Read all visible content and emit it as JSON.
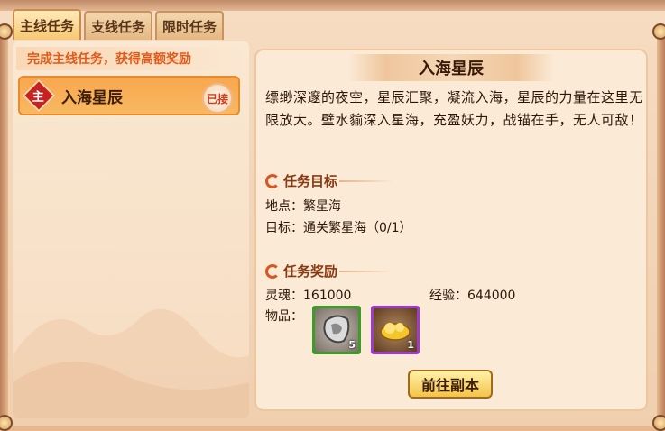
{
  "tabs": [
    {
      "label": "主线任务",
      "active": true
    },
    {
      "label": "支线任务",
      "active": false
    },
    {
      "label": "限时任务",
      "active": false
    }
  ],
  "left": {
    "hint": "完成主线任务，获得高额奖励",
    "task": {
      "badge": "主",
      "name": "入海星辰",
      "status": "已接"
    }
  },
  "detail": {
    "title": "入海星辰",
    "description": "缥缈深邃的夜空，星辰汇聚，凝流入海，星辰的力量在这里无限放大。壁水貐深入星海，充盈妖力，战锚在手，无人可敌！",
    "objective_header": "任务目标",
    "location_label": "地点：",
    "location_value": "繁星海",
    "goal_label": "目标：",
    "goal_value": "通关繁星海（0/1）",
    "reward_header": "任务奖励",
    "soul_label": "灵魂：",
    "soul_value": "161000",
    "exp_label": "经验：",
    "exp_value": "644000",
    "items_label": "物品：",
    "items": [
      {
        "icon": "silver-claw-icon",
        "count": "5",
        "rarity_color": "#3d9b2a"
      },
      {
        "icon": "golden-cloud-icon",
        "count": "1",
        "rarity_color": "#a13ac8"
      }
    ],
    "go_button": "前往副本"
  }
}
